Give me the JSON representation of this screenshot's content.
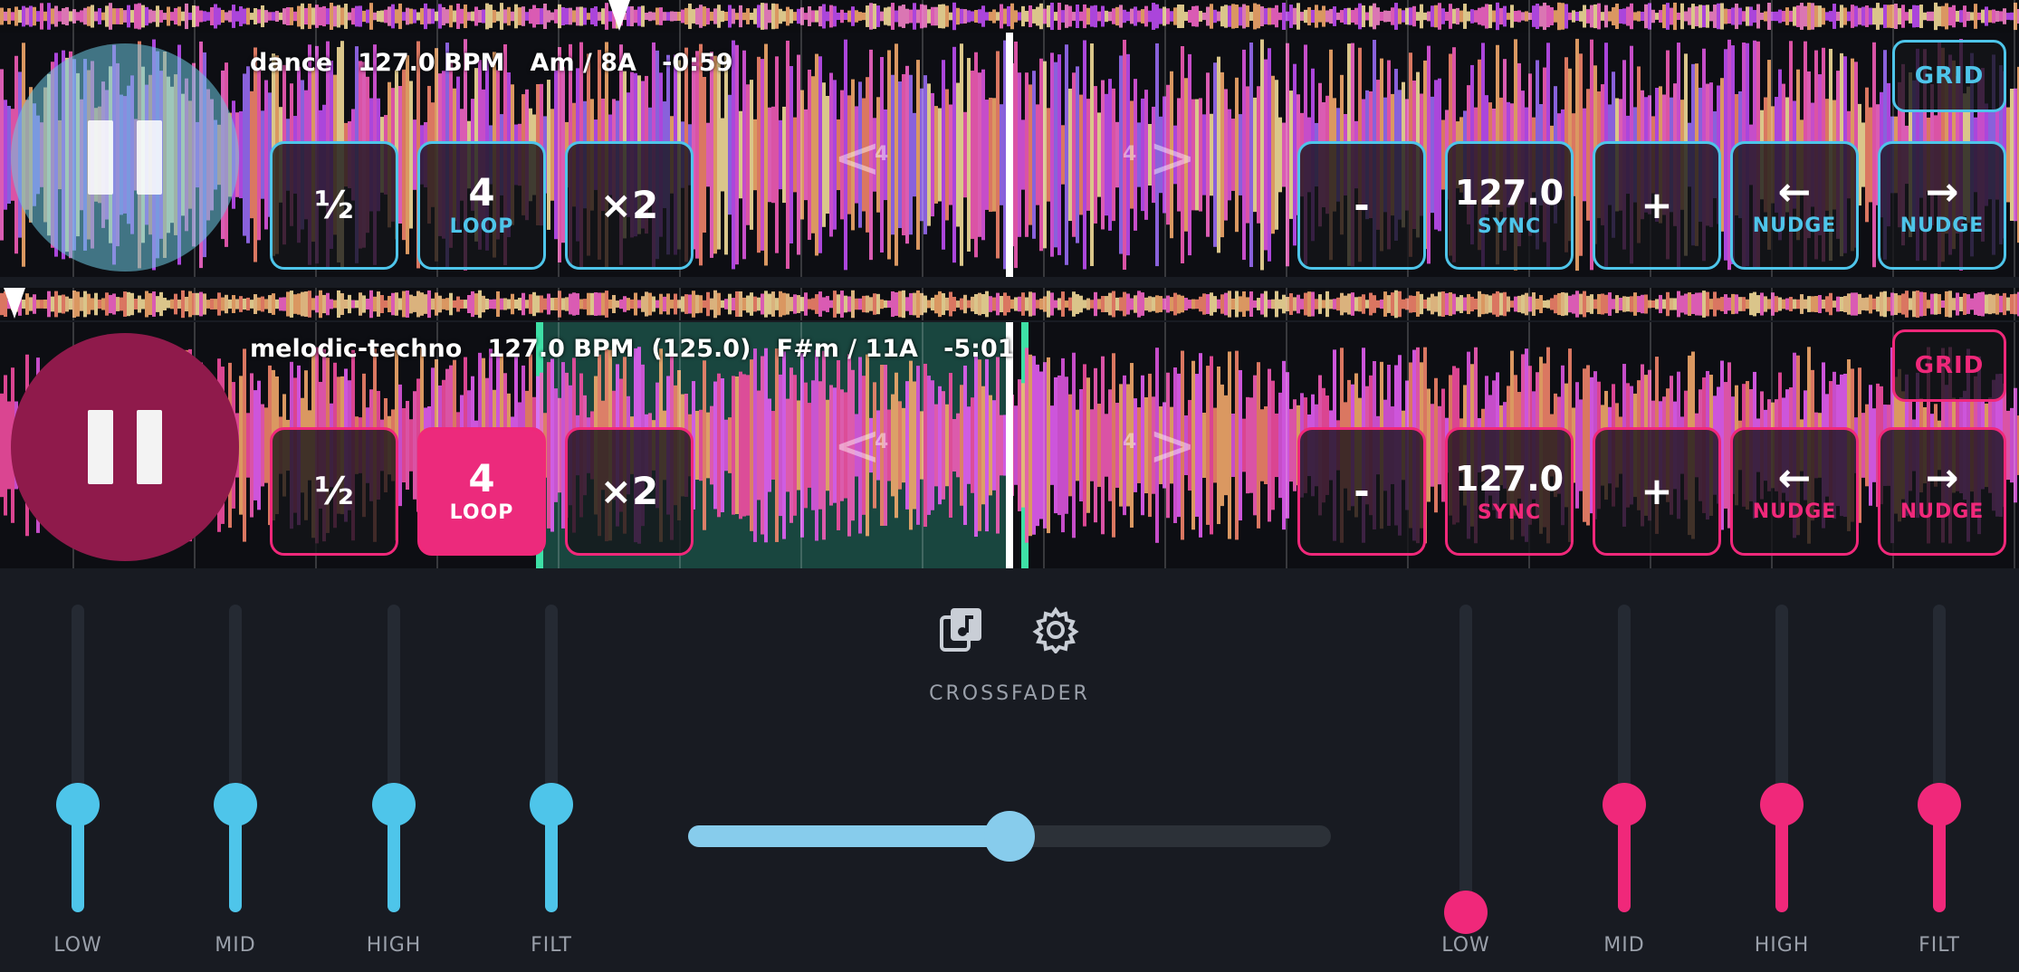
{
  "deck_a": {
    "track": "dance",
    "bpm": "127.0 BPM",
    "key": "Am / 8A",
    "time": "-0:59",
    "accent": "#4ec5ea",
    "play_state": "paused",
    "half_label": "½",
    "loop_value": "4",
    "loop_label": "LOOP",
    "double_label": "×2",
    "beatjump": "4",
    "minus_label": "-",
    "tempo_value": "127.0",
    "sync_label": "SYNC",
    "plus_label": "+",
    "nudge_back_label": "NUDGE",
    "nudge_fwd_label": "NUDGE",
    "grid_label": "GRID",
    "loop_active": false
  },
  "deck_b": {
    "track": "melodic-techno",
    "bpm": "127.0 BPM",
    "original_bpm": "(125.0)",
    "key": "F#m / 11A",
    "time": "-5:01",
    "accent": "#f0287a",
    "play_state": "paused",
    "half_label": "½",
    "loop_value": "4",
    "loop_label": "LOOP",
    "double_label": "×2",
    "beatjump": "4",
    "minus_label": "-",
    "tempo_value": "127.0",
    "sync_label": "SYNC",
    "plus_label": "+",
    "nudge_back_label": "NUDGE",
    "nudge_fwd_label": "NUDGE",
    "grid_label": "GRID",
    "loop_active": true
  },
  "mixer": {
    "crossfader_label": "CROSSFADER",
    "crossfader_value": 0.5,
    "library_icon": "music-library-icon",
    "settings_icon": "gear-icon",
    "eq_a": [
      {
        "label": "LOW",
        "value": 0.35
      },
      {
        "label": "MID",
        "value": 0.35
      },
      {
        "label": "HIGH",
        "value": 0.35
      },
      {
        "label": "FILT",
        "value": 0.35
      }
    ],
    "eq_b": [
      {
        "label": "LOW",
        "value": 0.0
      },
      {
        "label": "MID",
        "value": 0.35
      },
      {
        "label": "HIGH",
        "value": 0.35
      },
      {
        "label": "FILT",
        "value": 0.35
      }
    ],
    "colors": {
      "deck_a": "#4ec5ea",
      "deck_b": "#f0287a",
      "crossfader": "#87ccec"
    }
  }
}
